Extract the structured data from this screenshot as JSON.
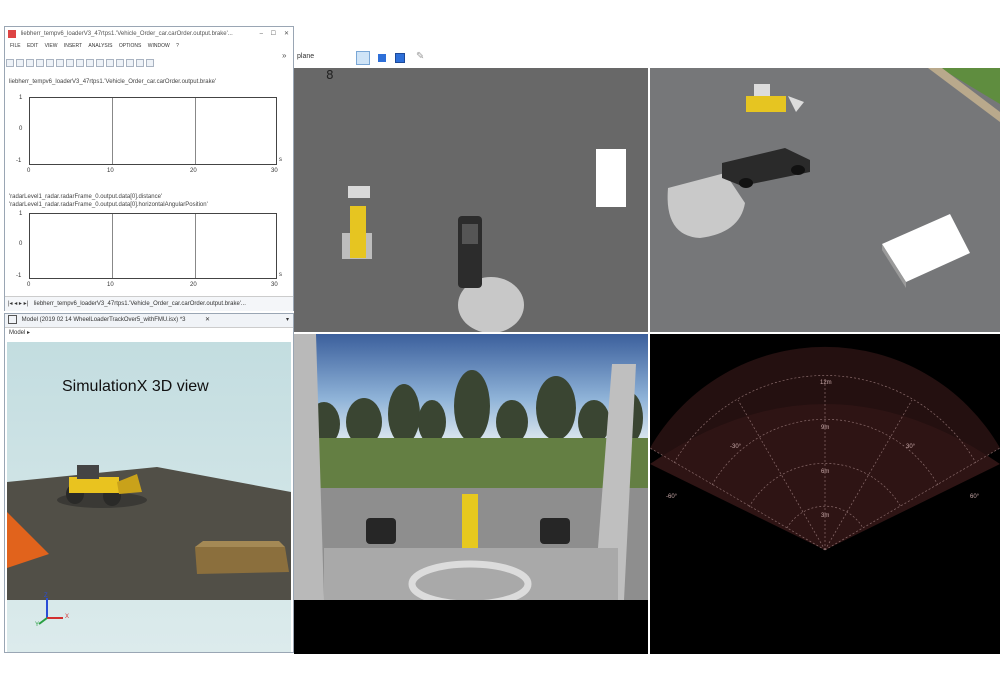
{
  "scope_window": {
    "title": "liebherr_tempv6_loaderV3_47rtps1.'Vehicle_Order_car.carOrder.output.brake'...",
    "menu": [
      "FILE",
      "EDIT",
      "VIEW",
      "INSERT",
      "ANALYSIS",
      "OPTIONS",
      "WINDOW",
      "?"
    ],
    "plot1": {
      "label": "liebherr_tempv6_loaderV3_47rtps1.'Vehicle_Order_car.carOrder.output.brake'",
      "y_ticks": [
        "1",
        "0",
        "-1"
      ],
      "x_ticks": [
        "0",
        "10",
        "20",
        "30"
      ],
      "x_unit": "s"
    },
    "plot2": {
      "label_a": "'radarLevel1_radar.radarFrame_0.output.data[0].distance'",
      "label_b": "'radarLevel1_radar.radarFrame_0.output.data[0].horizontalAngularPosition'",
      "y_ticks": [
        "1",
        "0",
        "-1"
      ],
      "x_ticks": [
        "0",
        "10",
        "20",
        "30"
      ],
      "x_unit": "s"
    },
    "status_tab": "liebherr_tempv6_loaderV3_47rtps1.'Vehicle_Order_car.carOrder.output.brake'..."
  },
  "model_window": {
    "title": "Model (2019 02 14 WheelLoaderTrackOver5_withFMU.isx) *3",
    "sub": "Model ▸",
    "view_title": "SimulationX 3D view",
    "axes": {
      "z": "Z",
      "y": "Y",
      "x": "X"
    }
  },
  "main_view": {
    "plane_label": "plane",
    "frame_counter": "8"
  },
  "radar": {
    "range_labels": [
      "12m",
      "9m",
      "6m",
      "3m"
    ],
    "angle_labels": [
      "-30°",
      "30°",
      "-60°",
      "60°"
    ]
  }
}
